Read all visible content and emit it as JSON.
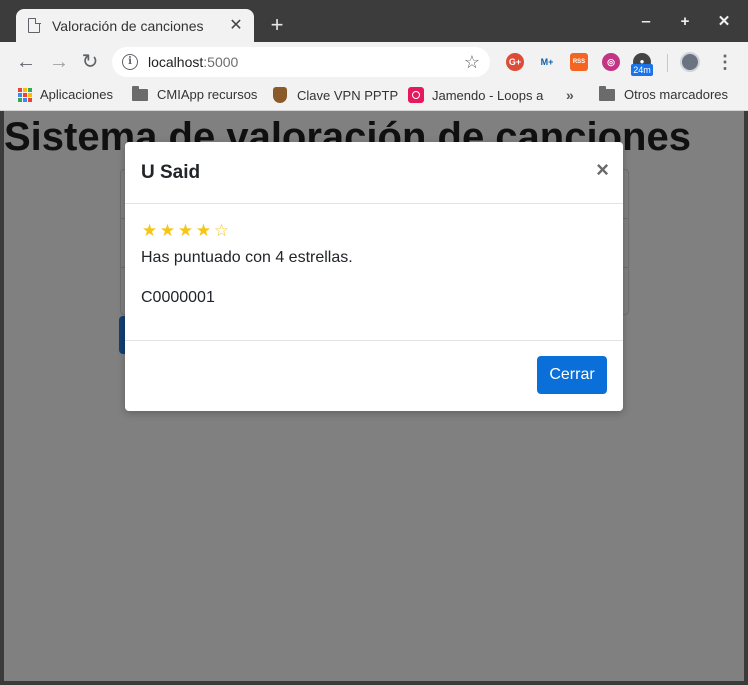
{
  "browser": {
    "tab": {
      "title": "Valoración de canciones",
      "close": "✕"
    },
    "new_tab": "+",
    "window_controls": {
      "minimize": "‒",
      "maximize": "+",
      "close": "✕"
    },
    "nav": {
      "back": "←",
      "forward": "→",
      "reload": "↻"
    },
    "address": {
      "host": "localhost",
      "port": ":5000"
    },
    "extensions": [
      {
        "name": "google-plus",
        "label": "G+",
        "color": "#dd4b39"
      },
      {
        "name": "movistar",
        "label": "M+",
        "color": "#0b5ea8"
      },
      {
        "name": "rss",
        "label": "RSS",
        "color": "#f26522"
      },
      {
        "name": "camera",
        "label": "◎",
        "color": "#c13584"
      },
      {
        "name": "timer",
        "label": "●",
        "color": "#444444"
      }
    ],
    "timer_badge": "24m",
    "menu": "⋮"
  },
  "bookmarks": {
    "items": [
      {
        "label": "Aplicaciones",
        "icon": "apps-grid-icon"
      },
      {
        "label": "CMIApp recursos",
        "icon": "folder-icon"
      },
      {
        "label": "Clave VPN PPTP",
        "icon": "crest-icon"
      },
      {
        "label": "Jamendo - Loops a",
        "icon": "jamendo-icon"
      }
    ],
    "more": "»",
    "other": {
      "label": "Otros marcadores",
      "icon": "folder-icon"
    }
  },
  "page": {
    "heading": "Sistema de valoración de canciones"
  },
  "modal": {
    "title": "U Said",
    "close": "×",
    "rating": {
      "value": 4,
      "max": 5
    },
    "rating_text": "Has puntuado con 4 estrellas.",
    "code": "C0000001",
    "button_label": "Cerrar"
  },
  "colors": {
    "accent": "#0a6fd8",
    "star": "#f5c518",
    "overlay": "#808080"
  }
}
